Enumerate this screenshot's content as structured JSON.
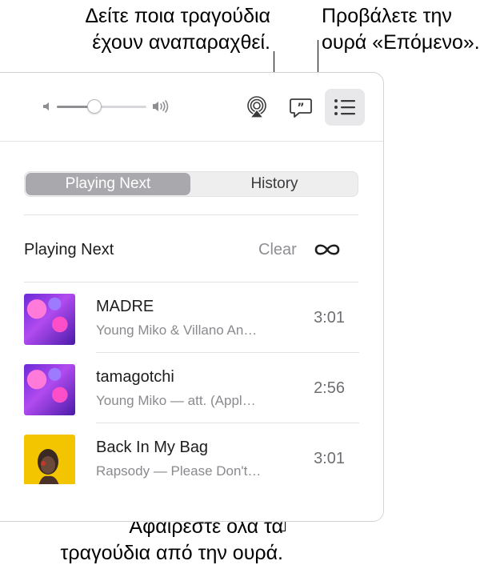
{
  "callouts": {
    "history": "Δείτε ποια τραγούδια\nέχουν αναπαραχθεί.",
    "queue": "Προβάλετε την\nουρά «Επόμενο».",
    "clear": "Αφαιρέστε όλα τα\nτραγούδια από την ουρά."
  },
  "toolbar": {
    "volume_level": 0.42,
    "icons": {
      "volume_low": "speaker-low-icon",
      "volume_high": "speaker-high-icon",
      "airplay": "airplay-icon",
      "lyrics": "lyrics-quote-icon",
      "queue": "list-icon"
    }
  },
  "segmented": {
    "selected": "Playing Next",
    "options": [
      "Playing Next",
      "History"
    ]
  },
  "playing_next": {
    "title": "Playing Next",
    "clear_label": "Clear",
    "autoplay_icon": "infinity-icon",
    "songs": [
      {
        "title": "MADRE",
        "subtitle": "Young Miko & Villano An…",
        "duration": "3:01"
      },
      {
        "title": "tamagotchi",
        "subtitle": "Young Miko — att. (Appl…",
        "duration": "2:56"
      },
      {
        "title": "Back In My Bag",
        "subtitle": "Rapsody — Please Don't…",
        "duration": "3:01"
      }
    ]
  },
  "colors": {
    "accent_selected_segment": "#a9a9ad",
    "secondary_text": "#8a8a8e",
    "queue_button_bg": "#e8e8ea"
  }
}
